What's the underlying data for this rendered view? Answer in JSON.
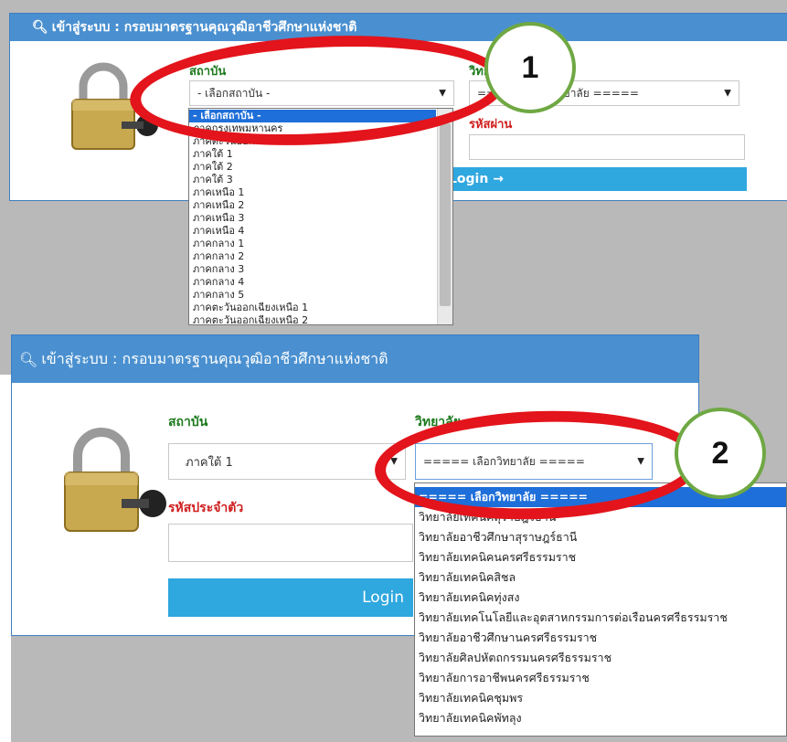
{
  "top_panel": {
    "header_title": "เข้าสู่ระบบ : กรอบมาตรฐานคุณวุฒิอาชีวศึกษาแห่งชาติ",
    "institution_label": "สถาบัน",
    "institution_selected": "- เลือกสถาบัน -",
    "college_label": "วิทยาลัย",
    "college_selected": "===== เลือกวิทยาลัย =====",
    "password_label": "รหัสผ่าน",
    "login_label": "Login →",
    "institution_options": [
      "- เลือกสถาบัน -",
      "ภาคกรุงเทพมหานคร",
      "ภาคตะวันออก",
      "ภาคใต้ 1",
      "ภาคใต้ 2",
      "ภาคใต้ 3",
      "ภาคเหนือ 1",
      "ภาคเหนือ 2",
      "ภาคเหนือ 3",
      "ภาคเหนือ 4",
      "ภาคกลาง 1",
      "ภาคกลาง 2",
      "ภาคกลาง 3",
      "ภาคกลาง 4",
      "ภาคกลาง 5",
      "ภาคตะวันออกเฉียงเหนือ 1",
      "ภาคตะวันออกเฉียงเหนือ 2"
    ]
  },
  "bottom_panel": {
    "header_title": "เข้าสู่ระบบ : กรอบมาตรฐานคุณวุฒิอาชีวศึกษาแห่งชาติ",
    "institution_label": "สถาบัน",
    "institution_selected": "ภาคใต้ 1",
    "college_label": "วิทยาลัย",
    "college_selected": "===== เลือกวิทยาลัย =====",
    "id_label": "รหัสประจำตัว",
    "login_label": "Login",
    "college_options": [
      "===== เลือกวิทยาลัย =====",
      "วิทยาลัยเทคนิคสุราษฎร์ธานี",
      "วิทยาลัยอาชีวศึกษาสุราษฎร์ธานี",
      "วิทยาลัยเทคนิคนครศรีธรรมราช",
      "วิทยาลัยเทคนิคสิชล",
      "วิทยาลัยเทคนิคทุ่งสง",
      "วิทยาลัยเทคโนโลยีและอุตสาหกรรมการต่อเรือนครศรีธรรมราช",
      "วิทยาลัยอาชีวศึกษานครศรีธรรมราช",
      "วิทยาลัยศิลปหัตถกรรมนครศรีธรรมราช",
      "วิทยาลัยการอาชีพนครศรีธรรมราช",
      "วิทยาลัยเทคนิคชุมพร",
      "วิทยาลัยเทคนิคพัทลุง"
    ]
  },
  "annotations": {
    "badge_1": "1",
    "badge_2": "2"
  },
  "colors": {
    "header_blue": "#4a90d0",
    "login_blue": "#2fa7df",
    "label_green": "#1d7a1d",
    "label_red": "#d01f1f",
    "highlight_red": "#e3141b",
    "badge_green": "#6fa843",
    "selected_option": "#1e6fd9"
  }
}
